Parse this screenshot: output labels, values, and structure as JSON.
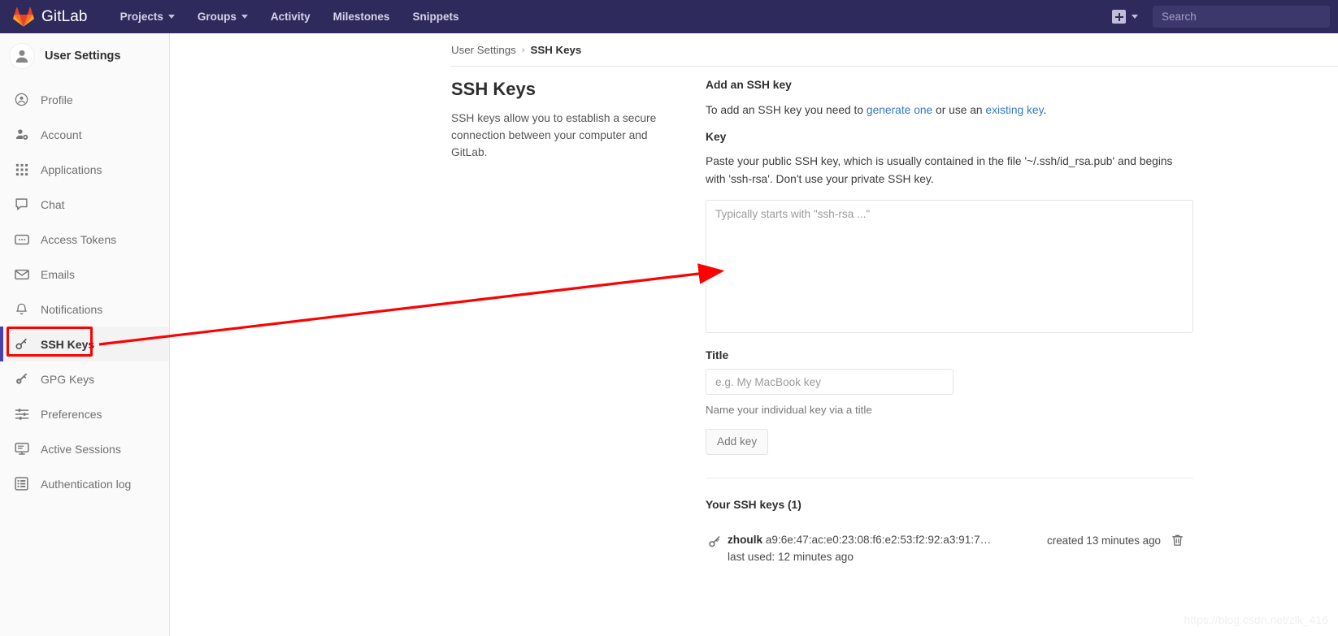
{
  "navbar": {
    "brand": "GitLab",
    "brand_icon": "gitlab-fox-logo",
    "links": [
      {
        "label": "Projects",
        "has_caret": true
      },
      {
        "label": "Groups",
        "has_caret": true
      },
      {
        "label": "Activity",
        "has_caret": false
      },
      {
        "label": "Milestones",
        "has_caret": false
      },
      {
        "label": "Snippets",
        "has_caret": false
      }
    ],
    "plus_icon": "plus-square-icon",
    "plus_caret_icon": "chevron-down-icon",
    "search_placeholder": "Search"
  },
  "sidebar": {
    "avatar_icon": "user-avatar-icon",
    "title": "User Settings",
    "items": [
      {
        "label": "Profile",
        "icon": "user-circle-icon",
        "active": false
      },
      {
        "label": "Account",
        "icon": "user-gear-icon",
        "active": false
      },
      {
        "label": "Applications",
        "icon": "grid-apps-icon",
        "active": false
      },
      {
        "label": "Chat",
        "icon": "chat-bubble-icon",
        "active": false
      },
      {
        "label": "Access Tokens",
        "icon": "token-card-icon",
        "active": false
      },
      {
        "label": "Emails",
        "icon": "envelope-icon",
        "active": false
      },
      {
        "label": "Notifications",
        "icon": "bell-icon",
        "active": false
      },
      {
        "label": "SSH Keys",
        "icon": "key-icon",
        "active": true
      },
      {
        "label": "GPG Keys",
        "icon": "key-solid-icon",
        "active": false
      },
      {
        "label": "Preferences",
        "icon": "sliders-icon",
        "active": false
      },
      {
        "label": "Active Sessions",
        "icon": "monitor-icon",
        "active": false
      },
      {
        "label": "Authentication log",
        "icon": "list-table-icon",
        "active": false
      }
    ]
  },
  "breadcrumb": {
    "parent": "User Settings",
    "separator": "›",
    "current": "SSH Keys"
  },
  "page": {
    "title": "SSH Keys",
    "description": "SSH keys allow you to establish a secure connection between your computer and GitLab."
  },
  "form": {
    "heading": "Add an SSH key",
    "intro_prefix": "To add an SSH key you need to ",
    "intro_link1": "generate one",
    "intro_middle": " or use an ",
    "intro_link2": "existing key",
    "intro_suffix": ".",
    "key_label": "Key",
    "key_help": "Paste your public SSH key, which is usually contained in the file '~/.ssh/id_rsa.pub' and begins with 'ssh-rsa'. Don't use your private SSH key.",
    "key_placeholder": "Typically starts with \"ssh-rsa ...\"",
    "key_value": "",
    "title_label": "Title",
    "title_placeholder": "e.g. My MacBook key",
    "title_value": "",
    "title_hint": "Name your individual key via a title",
    "submit_label": "Add key"
  },
  "keys_section": {
    "heading": "Your SSH keys (1)",
    "rows": [
      {
        "icon": "key-icon",
        "owner": "zhoulk",
        "fingerprint": "a9:6e:47:ac:e0:23:08:f6:e2:53:f2:92:a3:91:7…",
        "last_used": "last used: 12 minutes ago",
        "created": "created 13 minutes ago",
        "delete_icon": "trash-icon"
      }
    ]
  },
  "annotation": {
    "type": "red-arrow-and-box",
    "target": "SSH Keys sidebar item",
    "color": "#fe0000"
  },
  "watermark": "https://blog.csdn.net/zlk_416",
  "colors": {
    "navbar_bg": "#2e2a5b",
    "sidebar_bg": "#fafafa",
    "active_marker": "#4b3fa8",
    "link": "#3578c6",
    "annotation": "#fe0000"
  }
}
